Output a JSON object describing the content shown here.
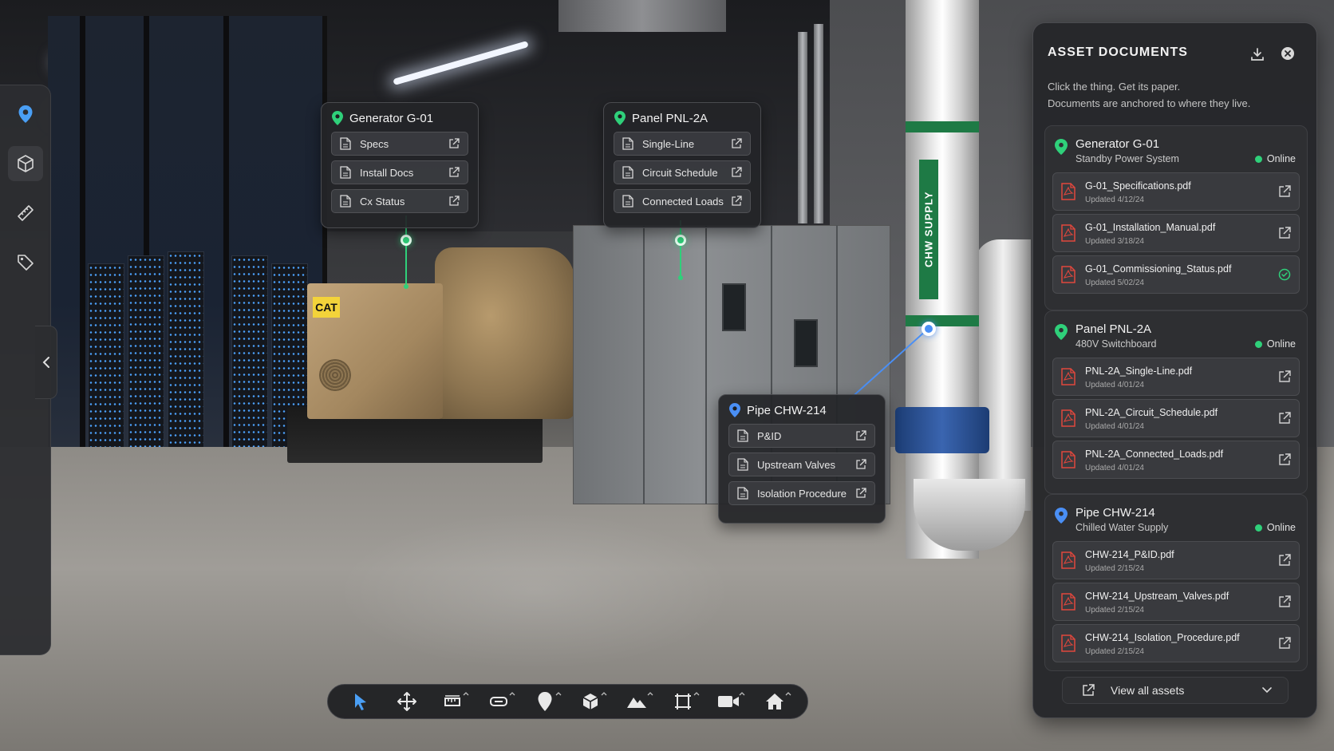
{
  "app": {
    "accent": "#2fd07a",
    "selection_accent": "#4a8ff5"
  },
  "scene": {
    "genset_logo": "CAT",
    "pipe_label": "CHW SUPPLY"
  },
  "left_toolbar": {
    "items": [
      {
        "name": "location-pin",
        "icon": "pin-icon",
        "active": false
      },
      {
        "name": "3d-model",
        "icon": "cube-icon",
        "active": true
      },
      {
        "name": "measure",
        "icon": "ruler-icon",
        "active": false
      },
      {
        "name": "tags",
        "icon": "tag-icon",
        "active": false
      }
    ],
    "collapse_icon": "chevron-left-icon"
  },
  "callouts": {
    "generator": {
      "title": "Generator G-01",
      "rows": [
        "Specs",
        "Install Docs",
        "Cx Status"
      ]
    },
    "panel": {
      "title": "Panel PNL-2A",
      "rows": [
        "Single-Line",
        "Circuit Schedule",
        "Connected Loads"
      ]
    },
    "pipe": {
      "title": "Pipe CHW-214",
      "rows": [
        "P&ID",
        "Upstream Valves",
        "Isolation Procedure"
      ]
    }
  },
  "bottom_toolbar": {
    "tools": [
      {
        "name": "select",
        "icon": "cursor-icon",
        "active": true
      },
      {
        "name": "move",
        "icon": "move-icon"
      },
      {
        "name": "measure",
        "icon": "ruler-icon"
      },
      {
        "name": "label",
        "icon": "label-icon"
      },
      {
        "name": "pin",
        "icon": "pin-icon"
      },
      {
        "name": "model",
        "icon": "cube-icon"
      },
      {
        "name": "terrain",
        "icon": "mountain-icon"
      },
      {
        "name": "crop",
        "icon": "crop-icon"
      },
      {
        "name": "camera",
        "icon": "video-icon"
      },
      {
        "name": "home",
        "icon": "home-icon"
      }
    ]
  },
  "docs_panel": {
    "title": "ASSET DOCUMENTS",
    "subtitle_1": "Click the thing. Get its paper.",
    "subtitle_2": "Documents are anchored to where they live.",
    "assets": [
      {
        "name": "Generator G-01",
        "type": "Standby Power System",
        "status": "Online",
        "pin_color": "#2fd07a",
        "docs": [
          {
            "file": "G-01_Specifications.pdf",
            "updated": "Updated 4/12/24",
            "action": "external-link-icon"
          },
          {
            "file": "G-01_Installation_Manual.pdf",
            "updated": "Updated 3/18/24",
            "action": "external-link-icon"
          },
          {
            "file": "G-01_Commissioning_Status.pdf",
            "updated": "Updated 5/02/24",
            "action": "check-circle-icon"
          }
        ]
      },
      {
        "name": "Panel PNL-2A",
        "type": "480V Switchboard",
        "status": "Online",
        "pin_color": "#2fd07a",
        "docs": [
          {
            "file": "PNL-2A_Single-Line.pdf",
            "updated": "Updated 4/01/24",
            "action": "external-link-icon"
          },
          {
            "file": "PNL-2A_Circuit_Schedule.pdf",
            "updated": "Updated 4/01/24",
            "action": "external-link-icon"
          },
          {
            "file": "PNL-2A_Connected_Loads.pdf",
            "updated": "Updated 4/01/24",
            "action": "external-link-icon"
          }
        ]
      },
      {
        "name": "Pipe CHW-214",
        "type": "Chilled Water Supply",
        "status": "Online",
        "pin_color": "#4a8ff5",
        "docs": [
          {
            "file": "CHW-214_P&ID.pdf",
            "updated": "Updated 2/15/24",
            "action": "external-link-icon"
          },
          {
            "file": "CHW-214_Upstream_Valves.pdf",
            "updated": "Updated 2/15/24",
            "action": "external-link-icon"
          },
          {
            "file": "CHW-214_Isolation_Procedure.pdf",
            "updated": "Updated 2/15/24",
            "action": "external-link-icon"
          }
        ]
      }
    ],
    "view_all_label": "View all assets"
  }
}
